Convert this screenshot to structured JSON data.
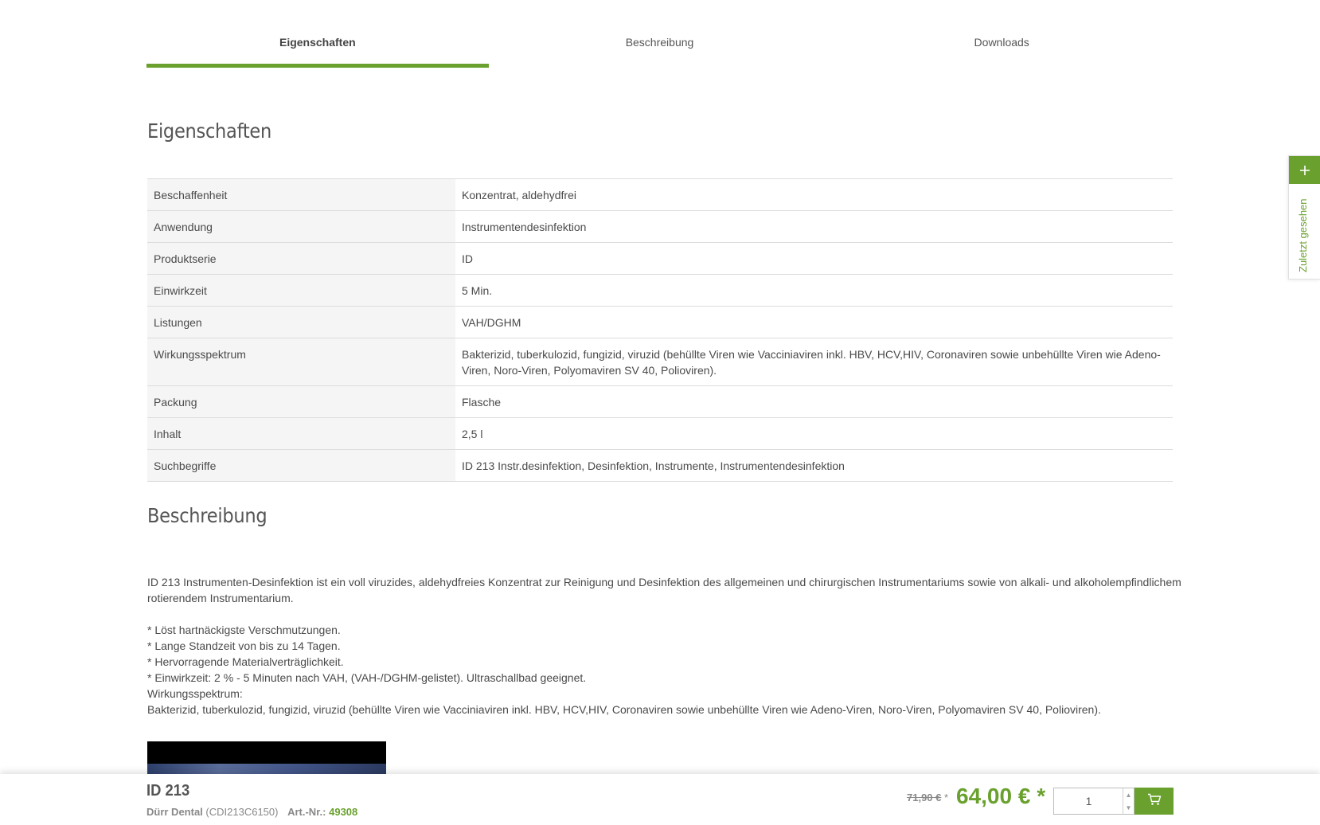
{
  "tabs": [
    {
      "label": "Eigenschaften",
      "active": true
    },
    {
      "label": "Beschreibung",
      "active": false
    },
    {
      "label": "Downloads",
      "active": false
    }
  ],
  "properties": {
    "title": "Eigenschaften",
    "rows": [
      {
        "key": "Beschaffenheit",
        "value": "Konzentrat, aldehydfrei"
      },
      {
        "key": "Anwendung",
        "value": "Instrumentendesinfektion"
      },
      {
        "key": "Produktserie",
        "value": "ID"
      },
      {
        "key": "Einwirkzeit",
        "value": "5 Min."
      },
      {
        "key": "Listungen",
        "value": "VAH/DGHM"
      },
      {
        "key": "Wirkungsspektrum",
        "value": "Bakterizid, tuberkulozid, fungizid, viruzid (behüllte Viren wie Vacciniaviren inkl. HBV, HCV,HIV, Coronaviren sowie unbehüllte Viren wie Adeno-Viren, Noro-Viren, Polyomaviren SV 40, Polioviren)."
      },
      {
        "key": "Packung",
        "value": "Flasche"
      },
      {
        "key": "Inhalt",
        "value": "2,5 l"
      },
      {
        "key": "Suchbegriffe",
        "value": "ID 213 Instr.desinfektion, Desinfektion, Instrumente, Instrumentendesinfektion"
      }
    ]
  },
  "description": {
    "title": "Beschreibung",
    "intro": "ID 213 Instrumenten-Desinfektion ist ein voll viruzides, aldehydfreies Konzentrat zur Reinigung und Desinfektion des allgemeinen und chirurgischen Instrumentariums sowie von alkali- und alkoholempfindlichem rotierendem Instrumentarium.",
    "lines": [
      "* Löst hartnäckigste Verschmutzungen.",
      "* Lange Standzeit von bis zu 14 Tagen.",
      "* Hervorragende Materialverträglichkeit.",
      "* Einwirkzeit: 2 % - 5 Minuten nach VAH, (VAH-/DGHM-gelistet). Ultraschallbad geeignet.",
      "Wirkungsspektrum:",
      "Bakterizid, tuberkulozid, fungizid, viruzid (behüllte Viren wie Vacciniaviren inkl. HBV, HCV,HIV, Coronaviren sowie unbehüllte Viren wie Adeno-Viren, Noro-Viren, Polyomaviren SV 40, Polioviren)."
    ]
  },
  "sidebar": {
    "recently_viewed_label": "Zuletzt gesehen",
    "plus_icon": "+"
  },
  "buybar": {
    "product_name": "ID 213",
    "brand": "Dürr Dental",
    "manufacturer_code": "(CDI213C6150)",
    "art_label": "Art.-Nr.:",
    "art_number": "49308",
    "old_price": "71,90 €",
    "old_price_star": "*",
    "new_price": "64,00 € *",
    "quantity": "1"
  },
  "colors": {
    "accent": "#6aa12e"
  }
}
